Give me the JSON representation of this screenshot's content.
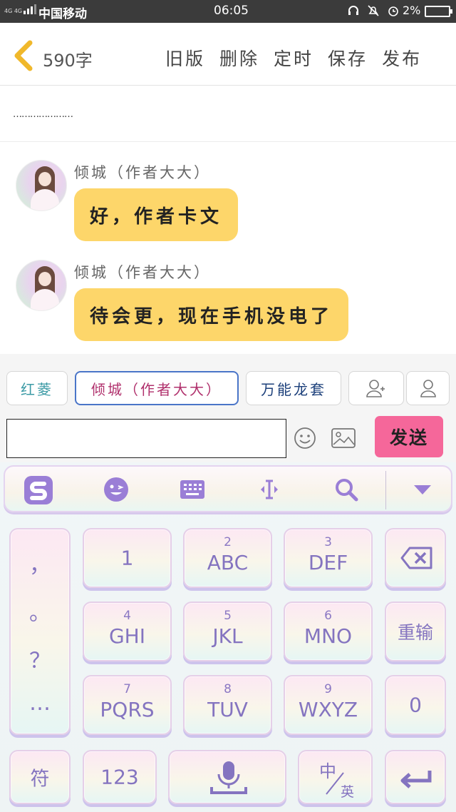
{
  "status_bar": {
    "network_small": "4G 4G",
    "carrier": "中国移动",
    "time": "06:05",
    "battery_percent": "2%",
    "battery_level": 0.02,
    "icons": [
      "headset-icon",
      "mute-icon",
      "alarm-icon"
    ]
  },
  "header": {
    "back_icon": "chevron-left-icon",
    "word_count": "590字",
    "actions": [
      "旧版",
      "删除",
      "定时",
      "保存",
      "发布"
    ]
  },
  "preview_text": "…………………",
  "messages": [
    {
      "name": "倾城（作者大大）",
      "text": "好，作者卡文"
    },
    {
      "name": "倾城（作者大大）",
      "text": "待会更，现在手机没电了"
    }
  ],
  "roles": {
    "items": [
      {
        "label": "红菱",
        "color": "#3b9aa5",
        "selected": false
      },
      {
        "label": "倾城（作者大大）",
        "color": "#b0306c",
        "selected": true
      },
      {
        "label": "万能龙套",
        "color": "#1b3f7a",
        "selected": false
      }
    ],
    "add_role_icon": "add-person-icon",
    "person_icon": "person-icon"
  },
  "input": {
    "placeholder": "",
    "value": "",
    "emoji_icon": "smiley-icon",
    "image_icon": "image-icon",
    "send_label": "发送"
  },
  "keyboard": {
    "toolbar_icons": [
      "sogou-logo-icon",
      "emoji-face-icon",
      "keyboard-icon",
      "cursor-icon",
      "search-icon",
      "collapse-down-icon"
    ],
    "punctuation": [
      "，",
      "。",
      "？",
      "…"
    ],
    "keys": [
      {
        "sub": "",
        "main": "1"
      },
      {
        "sub": "2",
        "main": "ABC"
      },
      {
        "sub": "3",
        "main": "DEF"
      },
      {
        "sub": "4",
        "main": "GHI"
      },
      {
        "sub": "5",
        "main": "JKL"
      },
      {
        "sub": "6",
        "main": "MNO"
      },
      {
        "sub": "7",
        "main": "PQRS"
      },
      {
        "sub": "8",
        "main": "TUV"
      },
      {
        "sub": "9",
        "main": "WXYZ"
      }
    ],
    "backspace_icon": "backspace-icon",
    "retype_label": "重输",
    "zero_label": "0",
    "symbols_label": "符",
    "numbers_label": "123",
    "mic_icon": "microphone-icon",
    "lang_top": "中",
    "lang_bottom": "英",
    "enter_icon": "enter-icon",
    "accent_color": "#8474c0"
  }
}
